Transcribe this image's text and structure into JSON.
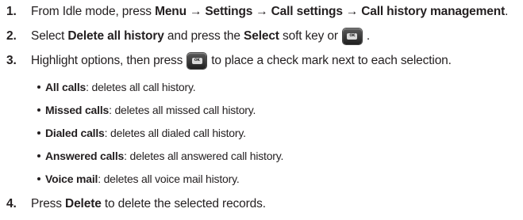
{
  "steps": [
    {
      "num": "1.",
      "lead": "From Idle mode, press",
      "path": [
        "Menu",
        "Settings",
        "Call settings",
        "Call history management"
      ],
      "arrow": "→",
      "end": "."
    },
    {
      "num": "2.",
      "pre": "Select",
      "bold1": "Delete all history",
      "mid": "and press the",
      "bold2": "Select",
      "post": "soft key or",
      "end": "."
    },
    {
      "num": "3.",
      "pre": "Highlight options, then press",
      "post": "to place a check mark next to each selection."
    },
    {
      "num": "4.",
      "pre": "Press",
      "bold1": "Delete",
      "post": "to delete the selected records."
    }
  ],
  "options": [
    {
      "term": "All calls",
      "desc": ": deletes all call history."
    },
    {
      "term": "Missed calls",
      "desc": ": deletes all missed call history."
    },
    {
      "term": "Dialed calls",
      "desc": ": deletes all dialed call history."
    },
    {
      "term": "Answered calls",
      "desc": ": deletes all answered call history."
    },
    {
      "term": "Voice mail",
      "desc": ": deletes all voice mail history."
    }
  ],
  "ok_key": {
    "label": "OK",
    "icon": "ok-key-icon"
  }
}
